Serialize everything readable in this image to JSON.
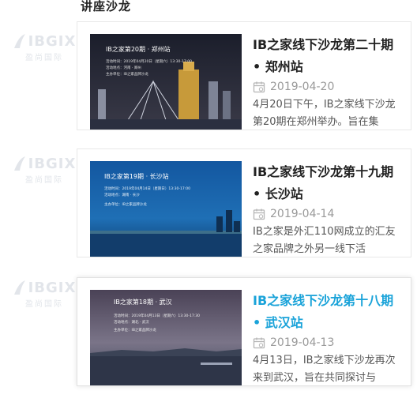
{
  "section": {
    "title": "讲座沙龙"
  },
  "watermark": {
    "word": "IBGIX",
    "sub": "盈尚国际"
  },
  "cards": [
    {
      "title_line1": "IB之家线下沙龙第二十期",
      "title_line2": "• 郑州站",
      "date": "2019-04-20",
      "desc": "4月20日下午，IB之家线下沙龙第20期在郑州举办。旨在集",
      "thumb": {
        "headline": "IB之家第20期 · 郑州站",
        "line1": "活动时间：2019年04月20日（星期六）13:30-17:00",
        "line2": "活动地点：河南 · 郑州",
        "line3": "主办单位：IB之家品牌沙龙"
      }
    },
    {
      "title_line1": "IB之家线下沙龙第十九期",
      "title_line2": "• 长沙站",
      "date": "2019-04-14",
      "desc": "IB之家是外汇110网成立的汇友之家品牌之外另一线下活",
      "thumb": {
        "headline": "IB之家第19期 · 长沙站",
        "line1": "活动时间：2019年04月14日（星期日）13:30-17:00",
        "line2": "活动地点：湖南 · 长沙",
        "line3": "主办单位：IB之家品牌沙龙"
      }
    },
    {
      "title_line1": "IB之家线下沙龙第十八期",
      "title_line2": "• 武汉站",
      "date": "2019-04-13",
      "desc": "4月13日，IB之家线下沙龙再次来到武汉，旨在共同探讨与",
      "thumb": {
        "headline": "IB之家第18期 · 武汉",
        "line1": "活动时间：2019年04月13日（星期六）13:30-17:30",
        "line2": "活动地点：湖北 · 武汉",
        "line3": "主办单位：IB之家品牌沙龙"
      }
    }
  ]
}
